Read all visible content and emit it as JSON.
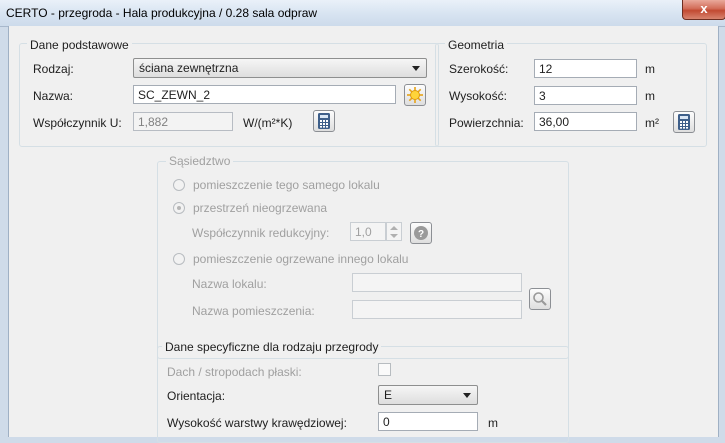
{
  "window": {
    "title": "CERTO - przegroda - Hala produkcyjna / 0.28 sala odpraw",
    "close_label": "x"
  },
  "basic": {
    "legend": "Dane podstawowe",
    "type_label": "Rodzaj:",
    "type_value": "ściana zewnętrzna",
    "name_label": "Nazwa:",
    "name_value": "SC_ZEWN_2",
    "u_label": "Współczynnik U:",
    "u_value": "1,882",
    "u_unit": "W/(m²*K)"
  },
  "geometry": {
    "legend": "Geometria",
    "width_label": "Szerokość:",
    "width_value": "12",
    "width_unit": "m",
    "height_label": "Wysokość:",
    "height_value": "3",
    "height_unit": "m",
    "area_label": "Powierzchnia:",
    "area_value": "36,00",
    "area_unit": "m²"
  },
  "neighborhood": {
    "legend": "Sąsiedztwo",
    "opt_same": "pomieszczenie tego samego lokalu",
    "opt_unheated": "przestrzeń nieogrzewana",
    "reduction_label": "Współczynnik redukcyjny:",
    "reduction_value": "1,0",
    "opt_other": "pomieszczenie ogrzewane innego lokalu",
    "unit_name_label": "Nazwa lokalu:",
    "unit_name_value": "",
    "room_name_label": "Nazwa pomieszczenia:",
    "room_name_value": ""
  },
  "specific": {
    "legend": "Dane specyficzne dla rodzaju przegrody",
    "roof_label": "Dach / stropodach płaski:",
    "orientation_label": "Orientacja:",
    "orientation_value": "E",
    "edge_height_label": "Wysokość warstwy krawędziowej:",
    "edge_height_value": "0",
    "edge_height_unit": "m"
  },
  "colors": {
    "title_bar": "#d7e3f1",
    "close_button": "#c9503a",
    "client_bg": "#f0f0f0"
  }
}
